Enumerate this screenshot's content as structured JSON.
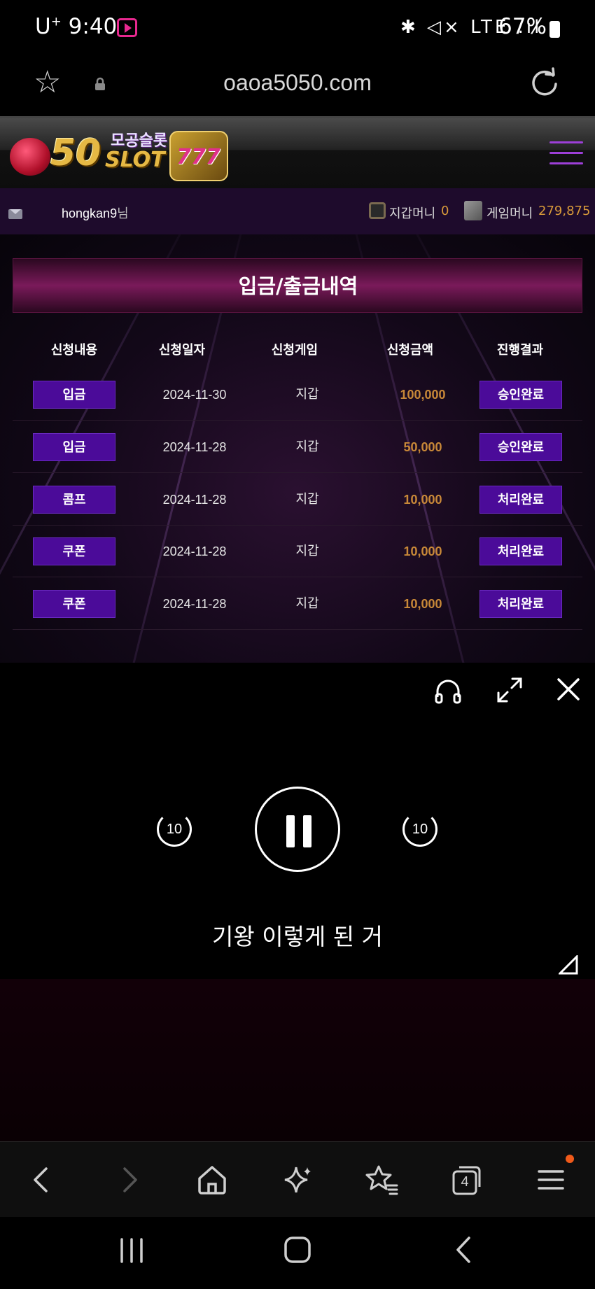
{
  "status_bar": {
    "carrier": "U",
    "carrier_sup": "+",
    "time": "9:40",
    "icons_text": "✱ ◁× LTE .ıl",
    "battery": "67%"
  },
  "browser": {
    "url": "oaoa5050.com"
  },
  "site": {
    "logo_number": "50",
    "logo_slot": "SLOT",
    "logo_korean": "모공슬롯",
    "logo_777": "777",
    "username": "hongkan9",
    "username_suffix": "님",
    "wallet_label": "지갑머니",
    "wallet_value": "0",
    "game_money_label": "게임머니",
    "game_money_value": "279,875"
  },
  "history": {
    "title": "입금/출금내역",
    "columns": [
      "신청내용",
      "신청일자",
      "신청게임",
      "신청금액",
      "진행결과"
    ],
    "rows": [
      {
        "type": "입금",
        "date": "2024-11-30",
        "game": "지갑",
        "amount": "100,000",
        "result": "승인완료"
      },
      {
        "type": "입금",
        "date": "2024-11-28",
        "game": "지갑",
        "amount": "50,000",
        "result": "승인완료"
      },
      {
        "type": "콤프",
        "date": "2024-11-28",
        "game": "지갑",
        "amount": "10,000",
        "result": "처리완료"
      },
      {
        "type": "쿠폰",
        "date": "2024-11-28",
        "game": "지갑",
        "amount": "10,000",
        "result": "처리완료"
      },
      {
        "type": "쿠폰",
        "date": "2024-11-28",
        "game": "지갑",
        "amount": "10,000",
        "result": "처리완료"
      }
    ]
  },
  "player": {
    "rewind_label": "10",
    "forward_label": "10",
    "caption": "기왕 이렇게 된 거"
  },
  "toolbar": {
    "tabs_count": "4"
  },
  "colors": {
    "accent_purple": "#4b0b99",
    "amount_gold": "#c88838",
    "menu_purple": "#9d3fd8",
    "notification_dot": "#f05a1a"
  }
}
